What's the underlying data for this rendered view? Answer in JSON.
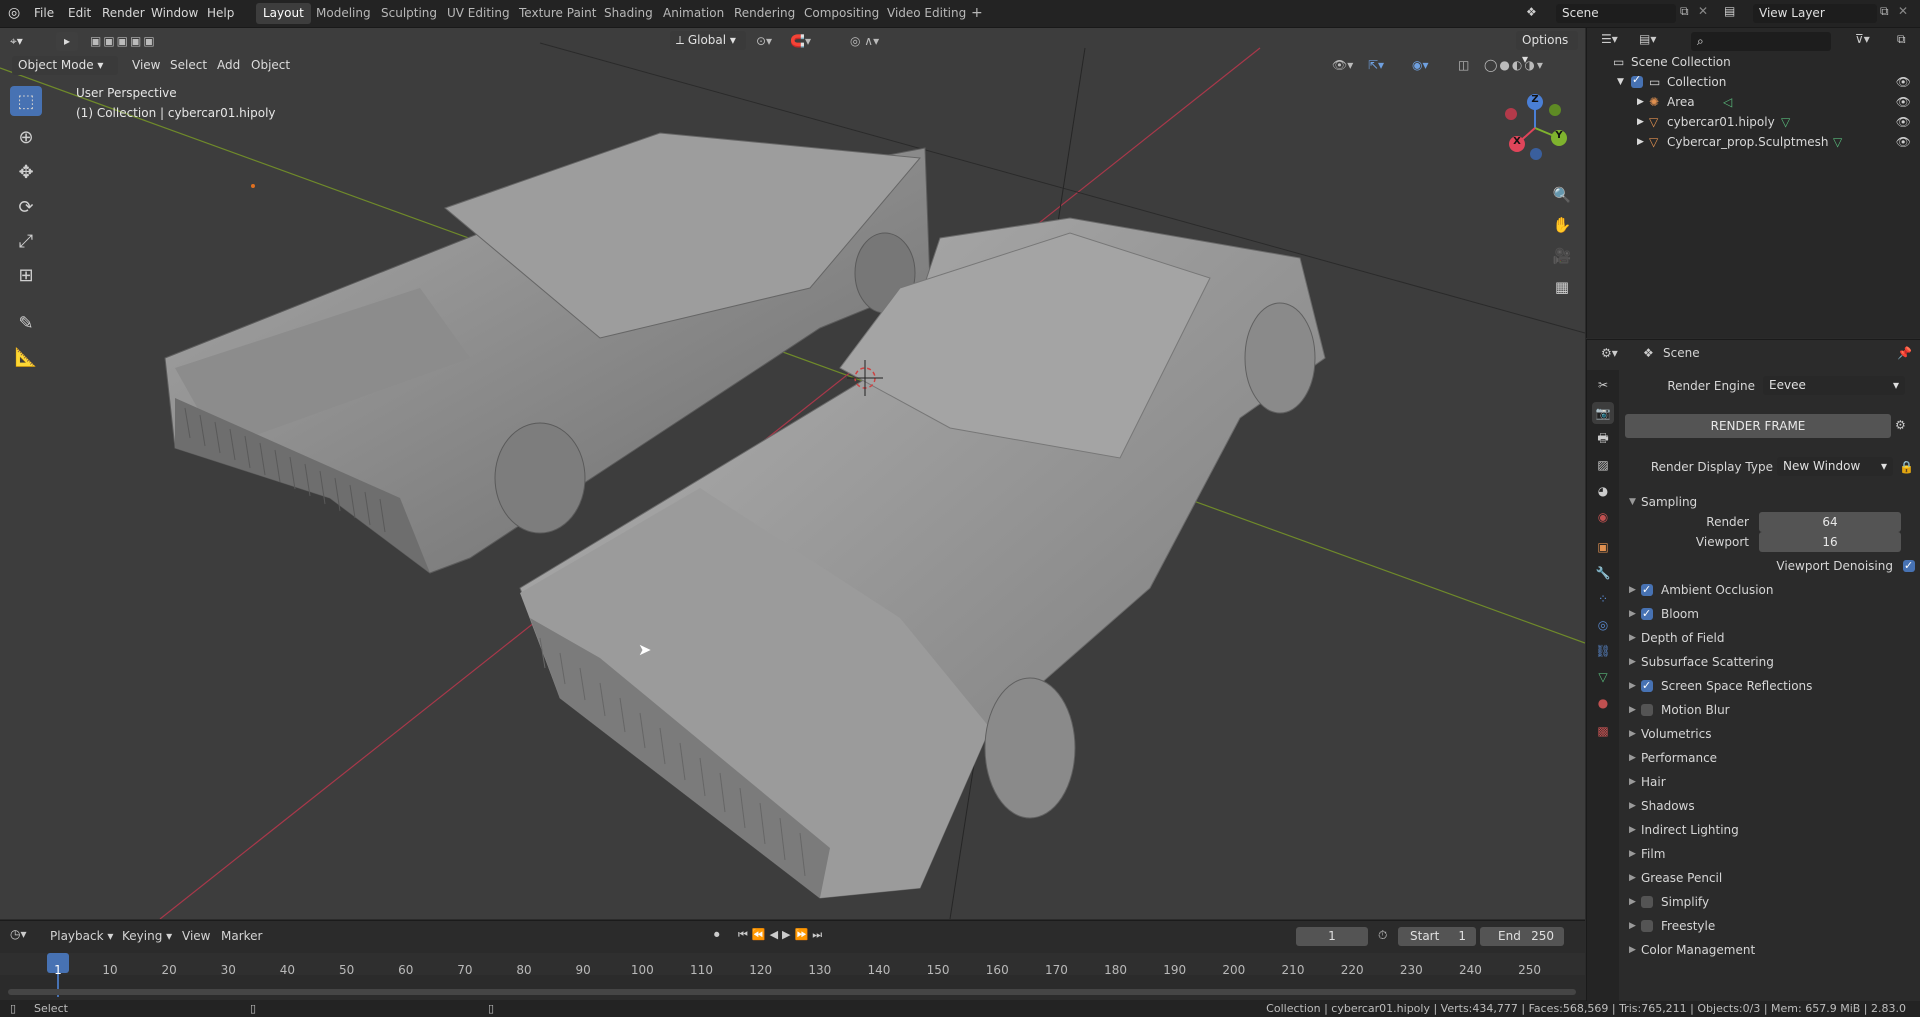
{
  "menu": [
    "File",
    "Edit",
    "Render",
    "Window",
    "Help"
  ],
  "workspaces": [
    {
      "label": "Layout",
      "active": true
    },
    {
      "label": "Modeling"
    },
    {
      "label": "Sculpting"
    },
    {
      "label": "UV Editing"
    },
    {
      "label": "Texture Paint"
    },
    {
      "label": "Shading"
    },
    {
      "label": "Animation"
    },
    {
      "label": "Rendering"
    },
    {
      "label": "Compositing"
    },
    {
      "label": "Video Editing"
    }
  ],
  "scene_name": "Scene",
  "view_layer": "View Layer",
  "viewport": {
    "mode": "Object Mode",
    "menus": [
      "View",
      "Select",
      "Add",
      "Object"
    ],
    "transform_orientation": "Global",
    "options_label": "Options",
    "overlay_title": "User Perspective",
    "overlay_subtitle": "(1) Collection | cybercar01.hipoly",
    "gizmo_axes": {
      "x": "X",
      "y": "Y",
      "z": "Z"
    }
  },
  "outliner": {
    "root": "Scene Collection",
    "collection": "Collection",
    "items": [
      "Area",
      "cybercar01.hipoly",
      "Cybercar_prop.Sculptmesh"
    ]
  },
  "properties": {
    "header": "Scene",
    "render_engine_label": "Render Engine",
    "render_engine": "Eevee",
    "render_frame_button": "RENDER FRAME",
    "render_display_type_label": "Render Display Type",
    "render_display_type": "New Window",
    "sampling": {
      "title": "Sampling",
      "render_label": "Render",
      "render_value": "64",
      "viewport_label": "Viewport",
      "viewport_value": "16",
      "denoising_label": "Viewport Denoising"
    },
    "panels": [
      {
        "label": "Ambient Occlusion",
        "checkbox": true,
        "checked": true
      },
      {
        "label": "Bloom",
        "checkbox": true,
        "checked": true
      },
      {
        "label": "Depth of Field",
        "checkbox": false
      },
      {
        "label": "Subsurface Scattering",
        "checkbox": false
      },
      {
        "label": "Screen Space Reflections",
        "checkbox": true,
        "checked": true
      },
      {
        "label": "Motion Blur",
        "checkbox": true,
        "checked": false
      },
      {
        "label": "Volumetrics",
        "checkbox": false
      },
      {
        "label": "Performance",
        "checkbox": false
      },
      {
        "label": "Hair",
        "checkbox": false
      },
      {
        "label": "Shadows",
        "checkbox": false
      },
      {
        "label": "Indirect Lighting",
        "checkbox": false
      },
      {
        "label": "Film",
        "checkbox": false
      },
      {
        "label": "Grease Pencil",
        "checkbox": false
      },
      {
        "label": "Simplify",
        "checkbox": true,
        "checked": false
      },
      {
        "label": "Freestyle",
        "checkbox": true,
        "checked": false
      },
      {
        "label": "Color Management",
        "checkbox": false
      }
    ]
  },
  "timeline": {
    "menus": [
      "Playback",
      "Keying",
      "View",
      "Marker"
    ],
    "current_frame": "1",
    "start_label": "Start",
    "start": "1",
    "end_label": "End",
    "end": "250",
    "ticks": [
      "1",
      "10",
      "20",
      "30",
      "40",
      "50",
      "60",
      "70",
      "80",
      "90",
      "100",
      "110",
      "120",
      "130",
      "140",
      "150",
      "160",
      "170",
      "180",
      "190",
      "200",
      "210",
      "220",
      "230",
      "240",
      "250"
    ]
  },
  "status": {
    "left": "Select",
    "right": "Collection | cybercar01.hipoly | Verts:434,777 | Faces:568,569 | Tris:765,211 | Objects:0/3 | Mem: 657.9 MiB | 2.83.0"
  }
}
